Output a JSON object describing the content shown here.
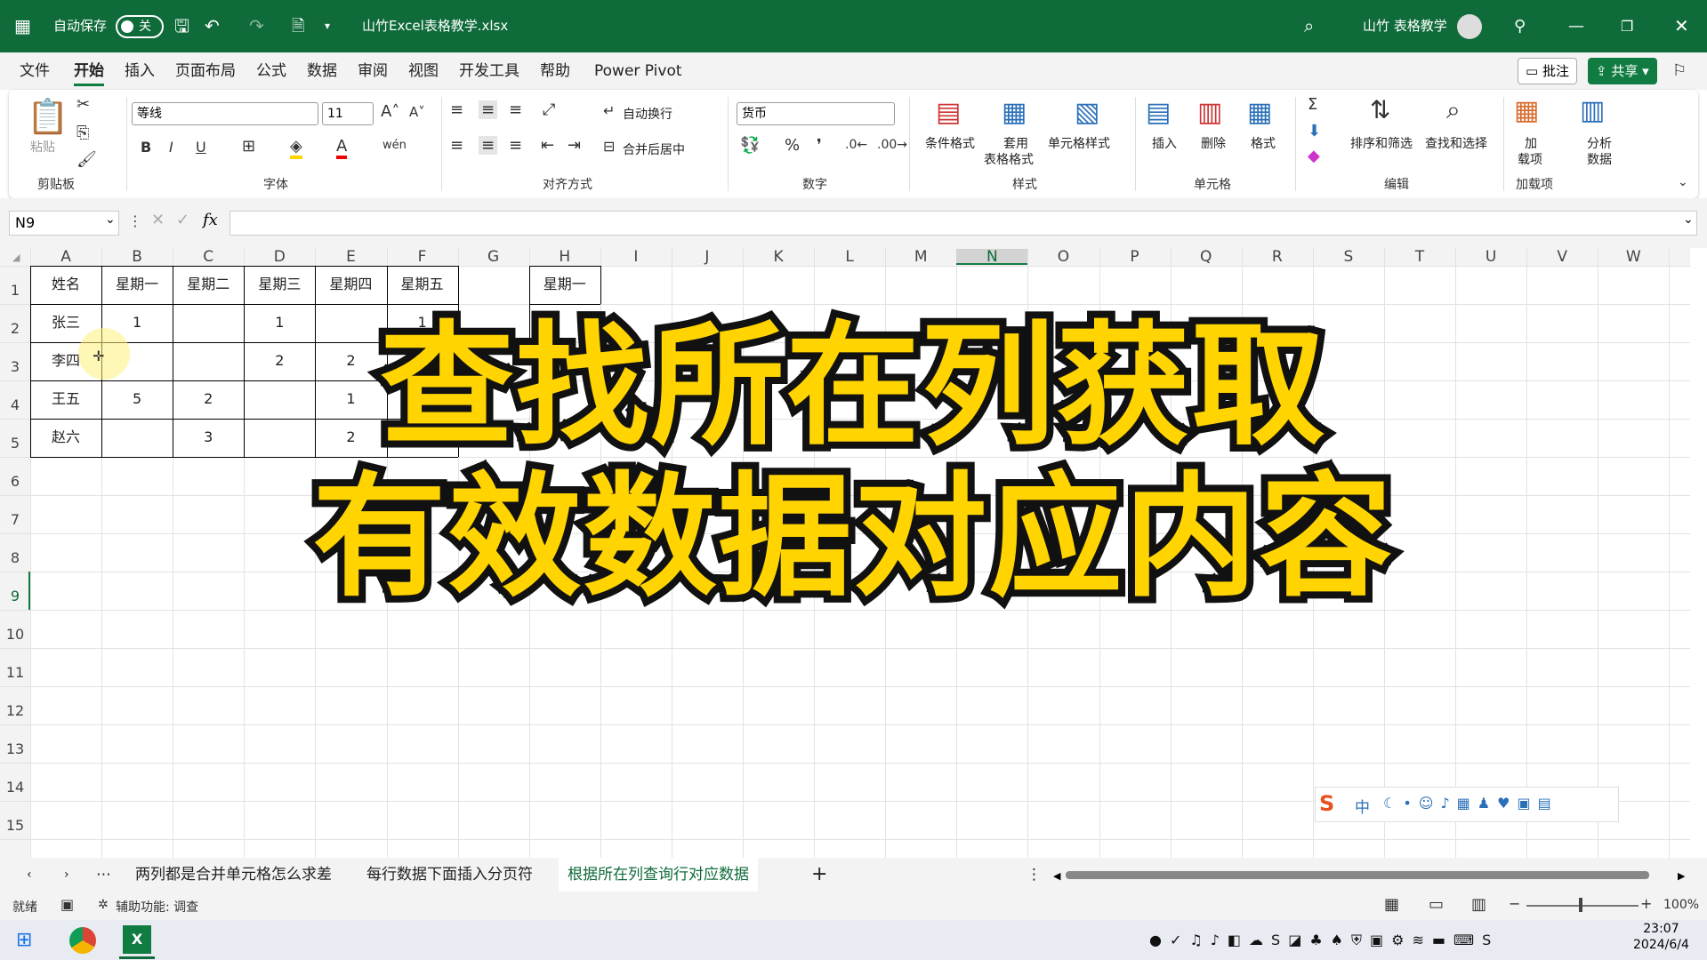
{
  "titlebar": {
    "autosave_label": "自动保存",
    "autosave_state": "关",
    "filename": "山竹Excel表格教学.xlsx",
    "user": "山竹 表格教学"
  },
  "menu": [
    "文件",
    "开始",
    "插入",
    "页面布局",
    "公式",
    "数据",
    "审阅",
    "视图",
    "开发工具",
    "帮助",
    "Power Pivot"
  ],
  "menu_active": "开始",
  "menu_right": {
    "comment": "批注",
    "share": "共享"
  },
  "ribbon": {
    "paste": "粘贴",
    "font_name": "等线",
    "font_size": "11",
    "wrap": "自动换行",
    "merge": "合并后居中",
    "number_format": "货币",
    "cond_format": "条件格式",
    "table_format_1": "套用",
    "table_format_2": "表格格式",
    "cell_style": "单元格样式",
    "insert": "插入",
    "delete": "删除",
    "format": "格式",
    "sort_filter": "排序和筛选",
    "find_select": "查找和选择",
    "addins_1": "加",
    "addins_2": "载项",
    "analyze_1": "分析",
    "analyze_2": "数据",
    "groups": {
      "clipboard": "剪贴板",
      "font": "字体",
      "align": "对齐方式",
      "number": "数字",
      "styles": "样式",
      "cells": "单元格",
      "editing": "编辑",
      "addins": "加载项"
    }
  },
  "formula_bar": {
    "name_box": "N9",
    "fx": "fx",
    "content": ""
  },
  "grid": {
    "columns": [
      "A",
      "B",
      "C",
      "D",
      "E",
      "F",
      "G",
      "H",
      "I",
      "J",
      "K",
      "L",
      "M",
      "N",
      "O",
      "P",
      "Q",
      "R",
      "S",
      "T",
      "U",
      "V",
      "W"
    ],
    "rows": [
      "1",
      "2",
      "3",
      "4",
      "5",
      "6",
      "7",
      "8",
      "9",
      "10",
      "11",
      "12",
      "13",
      "14",
      "15"
    ],
    "selected_column": "N",
    "selected_row": "9",
    "table": [
      [
        "姓名",
        "星期一",
        "星期二",
        "星期三",
        "星期四",
        "星期五"
      ],
      [
        "张三",
        "1",
        "",
        "1",
        "",
        "1"
      ],
      [
        "李四",
        "",
        "",
        "2",
        "2",
        ""
      ],
      [
        "王五",
        "5",
        "2",
        "",
        "1",
        ""
      ],
      [
        "赵六",
        "",
        "3",
        "",
        "2",
        ""
      ]
    ],
    "lookup_header": "星期一"
  },
  "overlay": {
    "line1": "查找所在列获取",
    "line2": "有效数据对应内容"
  },
  "ime": {
    "mode": "中"
  },
  "sheets": [
    "两列都是合并单元格怎么求差",
    "每行数据下面插入分页符",
    "根据所在列查询行对应数据"
  ],
  "active_sheet": "根据所在列查询行对应数据",
  "status": {
    "ready": "就绪",
    "accessibility": "辅助功能: 调查",
    "zoom": "100%"
  },
  "taskbar": {
    "time": "23:07",
    "date": "2024/6/4"
  },
  "colors": {
    "excel_green": "#0f6b3a",
    "overlay_fill": "#ffd400",
    "overlay_stroke": "#111111"
  }
}
